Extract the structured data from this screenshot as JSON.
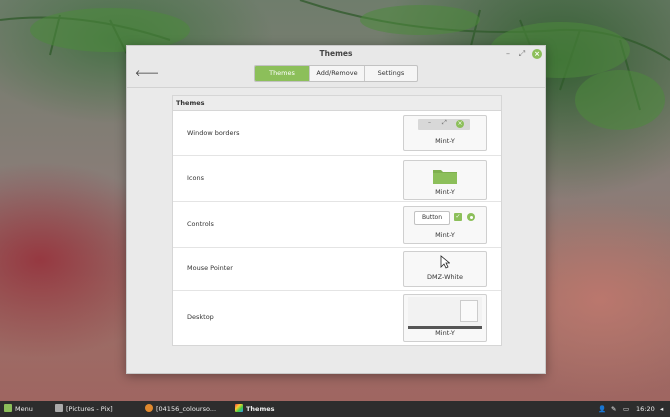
{
  "window": {
    "title": "Themes",
    "tabs": [
      {
        "label": "Themes",
        "active": true
      },
      {
        "label": "Add/Remove",
        "active": false
      },
      {
        "label": "Settings",
        "active": false
      }
    ]
  },
  "panel": {
    "header": "Themes",
    "rows": [
      {
        "label": "Window borders",
        "value": "Mint-Y"
      },
      {
        "label": "Icons",
        "value": "Mint-Y"
      },
      {
        "label": "Controls",
        "value": "Mint-Y",
        "button_label": "Button"
      },
      {
        "label": "Mouse Pointer",
        "value": "DMZ-White"
      },
      {
        "label": "Desktop",
        "value": "Mint-Y"
      }
    ]
  },
  "taskbar": {
    "menu_label": "Menu",
    "apps": [
      {
        "label": "[Pictures - Pix]"
      },
      {
        "label": "[04156_colourso..."
      },
      {
        "label": "Themes"
      }
    ],
    "clock": "16:20"
  },
  "colors": {
    "accent": "#8cbf5a",
    "taskbar": "#2d2d2d"
  },
  "icons": [
    "back-arrow-icon",
    "minimize-icon",
    "maximize-icon",
    "close-icon",
    "folder-icon",
    "checkbox-icon",
    "cursor-icon",
    "user-icon",
    "pen-icon",
    "battery-icon",
    "volume-icon"
  ]
}
